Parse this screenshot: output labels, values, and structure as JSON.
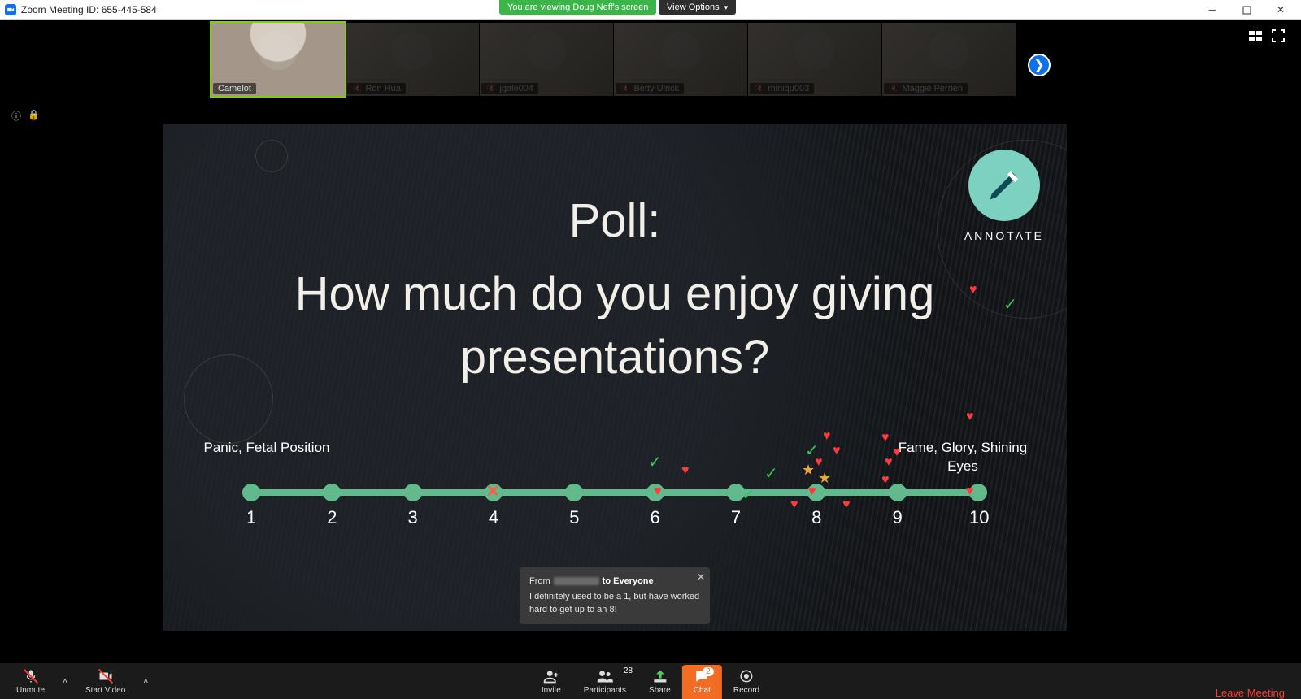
{
  "titlebar": {
    "app": "Zoom",
    "meeting_id_label": "Zoom Meeting ID: 655-445-584"
  },
  "banners": {
    "sharing": "You are viewing Doug Neff's screen",
    "view_options": "View Options"
  },
  "participants": [
    {
      "name": "Camelot",
      "active": true
    },
    {
      "name": "Ron Hua",
      "active": false
    },
    {
      "name": "jgale004",
      "active": false
    },
    {
      "name": "Betty Ulrick",
      "active": false
    },
    {
      "name": "mlniqu003",
      "active": false
    },
    {
      "name": "Maggie Perrien",
      "active": false
    }
  ],
  "slide": {
    "title": "Poll:",
    "question": "How much do you enjoy giving presentations?",
    "annotate_label": "ANNOTATE",
    "left_label": "Panic, Fetal Position",
    "right_label": "Fame, Glory, Shining Eyes",
    "scale": [
      "1",
      "2",
      "3",
      "4",
      "5",
      "6",
      "7",
      "8",
      "9",
      "10"
    ]
  },
  "chat_toast": {
    "prefix": "From",
    "to": "to Everyone",
    "body": "I definitely used to be a 1, but have worked hard to get up to an 8!"
  },
  "toolbar": {
    "unmute": "Unmute",
    "start_video": "Start Video",
    "invite": "Invite",
    "participants": "Participants",
    "participants_count": "28",
    "share": "Share",
    "chat": "Chat",
    "chat_count": "2",
    "record": "Record",
    "leave": "Leave Meeting"
  }
}
